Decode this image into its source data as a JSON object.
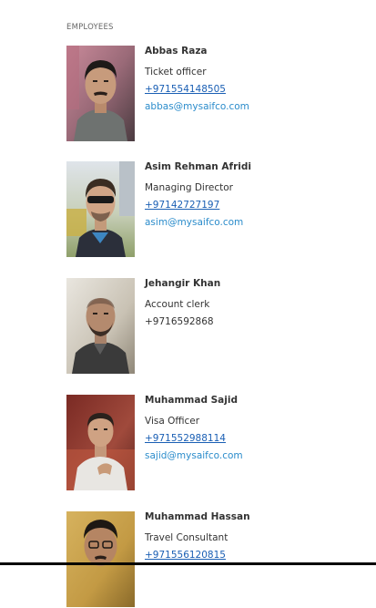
{
  "section": {
    "heading": "EMPLOYEES"
  },
  "employees": [
    {
      "name": "Abbas Raza",
      "title": "Ticket officer",
      "phone": "+971554148505",
      "email": "abbas@mysaifco.com"
    },
    {
      "name": "Asim Rehman Afridi",
      "title": "Managing Director",
      "phone": "+97142727197",
      "email": "asim@mysaifco.com"
    },
    {
      "name": "Jehangir Khan",
      "title": "Account clerk",
      "phone": "+9716592868",
      "email": ""
    },
    {
      "name": "Muhammad Sajid",
      "title": "Visa Officer",
      "phone": "+971552988114",
      "email": "sajid@mysaifco.com"
    },
    {
      "name": "Muhammad Hassan",
      "title": "Travel Consultant",
      "phone": "+971556120815",
      "email": ""
    }
  ],
  "colors": {
    "phone_link": "#1a5fb4",
    "email_link": "#2b8ccb",
    "text": "#333333"
  }
}
